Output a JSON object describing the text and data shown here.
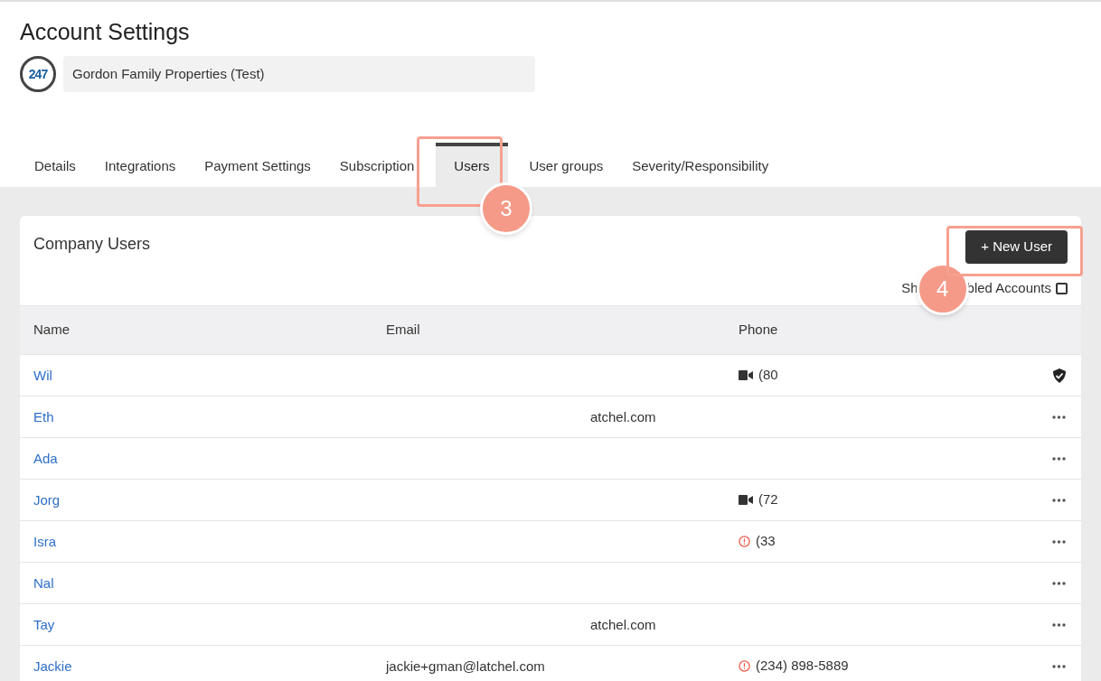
{
  "page_title": "Account Settings",
  "account": {
    "logo": "247",
    "name": "Gordon Family Properties (Test)"
  },
  "tabs": [
    {
      "label": "Details",
      "selected": false
    },
    {
      "label": "Integrations",
      "selected": false
    },
    {
      "label": "Payment Settings",
      "selected": false
    },
    {
      "label": "Subscription",
      "selected": false
    },
    {
      "label": "Users",
      "selected": true
    },
    {
      "label": "User groups",
      "selected": false
    },
    {
      "label": "Severity/Responsibility",
      "selected": false
    }
  ],
  "card": {
    "title": "Company Users",
    "new_button": "+ New User",
    "disabled_toggle": {
      "label_start": "Sh",
      "label_end": "bled Accounts",
      "checked": false
    }
  },
  "table": {
    "columns": [
      "Name",
      "Email",
      "Phone"
    ],
    "rows": [
      {
        "kind": "verified",
        "name": "Wil",
        "phone": {
          "text": "(80",
          "kind": "video"
        }
      },
      {
        "kind": "standard",
        "name": "Eth",
        "email": {
          "text": "atchel.com",
          "kind": "tail"
        }
      },
      {
        "kind": "standard",
        "name": "Ada"
      },
      {
        "kind": "standard",
        "name": "Jorg",
        "phone": {
          "text": "(72",
          "kind": "video"
        }
      },
      {
        "kind": "standard",
        "name": "Isra",
        "phone": {
          "text": "(33",
          "kind": "alert"
        }
      },
      {
        "kind": "standard",
        "name": "Nal"
      },
      {
        "kind": "standard",
        "name": "Tay",
        "email": {
          "text": "atchel.com",
          "kind": "tail"
        }
      },
      {
        "kind": "standard",
        "name": "Jackie",
        "email": {
          "text": "jackie+gman@latchel.com",
          "kind": "full"
        },
        "phone": {
          "text": "(234) 898-5889",
          "kind": "alert"
        }
      }
    ]
  },
  "callouts": [
    "3",
    "4"
  ]
}
